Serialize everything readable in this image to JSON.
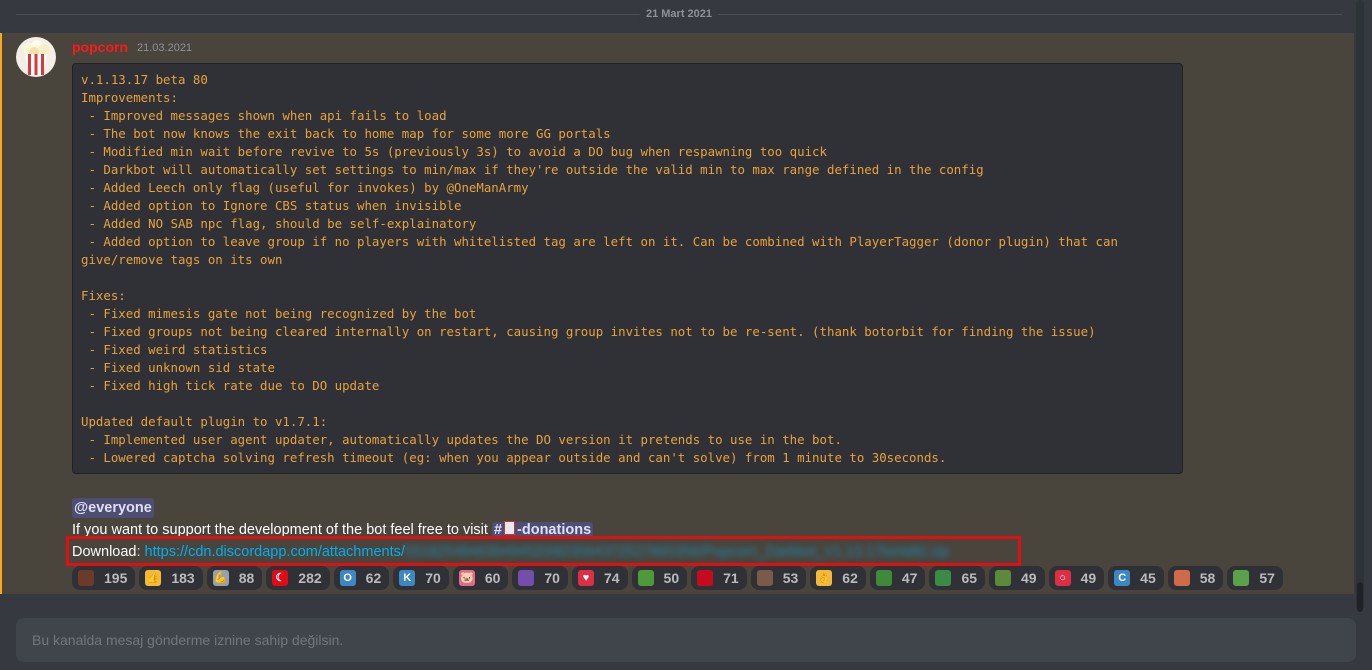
{
  "date_divider": "21 Mart 2021",
  "message": {
    "author": "popcorn",
    "timestamp": "21.03.2021",
    "code_lines": [
      "v.1.13.17 beta 80",
      "Improvements:",
      " - Improved messages shown when api fails to load",
      " - The bot now knows the exit back to home map for some more GG portals",
      " - Modified min wait before revive to 5s (previously 3s) to avoid a DO bug when respawning too quick",
      " - Darkbot will automatically set settings to min/max if they're outside the valid min to max range defined in the config",
      " - Added Leech only flag (useful for invokes) by @OneManArmy",
      " - Added option to Ignore CBS status when invisible",
      " - Added NO SAB npc flag, should be self-explainatory",
      " - Added option to leave group if no players with whitelisted tag are left on it. Can be combined with PlayerTagger (donor plugin) that can",
      "give/remove tags on its own",
      "",
      "Fixes:",
      " - Fixed mimesis gate not being recognized by the bot",
      " - Fixed groups not being cleared internally on restart, causing group invites not to be re-sent. (thank botorbit for finding the issue)",
      " - Fixed weird statistics",
      " - Fixed unknown sid state",
      " - Fixed high tick rate due to DO update",
      "",
      "Updated default plugin to v1.7.1:",
      " - Implemented user agent updater, automatically updates the DO version it pretends to use in the bot.",
      " - Lowered captcha solving refresh timeout (eg: when you appear outside and can't solve) from 1 minute to 30seconds."
    ],
    "mention": "@everyone",
    "support_text": "If you want to support the development of the bot feel free to visit ",
    "channel_mention": "-donations",
    "download_label": "Download: ",
    "download_url": "https://cdn.discordapp.com/attachments/",
    "download_url_blurred": "551825484639494520/823564372527865356/Popcorn_Darkbot_V1.13.17beta80.zip",
    "reactions": [
      {
        "icon": "bear-emoji",
        "count": "195",
        "color": "#6b3b2a",
        "glyph": ""
      },
      {
        "icon": "thumbs-up-emoji",
        "count": "183",
        "color": "#f5b93a",
        "glyph": "👍"
      },
      {
        "icon": "flexed-arm-emoji",
        "count": "88",
        "color": "#9aa0a8",
        "glyph": "💪"
      },
      {
        "icon": "turkey-flag-emoji",
        "count": "282",
        "color": "#e30a17",
        "glyph": "☾"
      },
      {
        "icon": "letter-o-emoji",
        "count": "62",
        "color": "#3b88c3",
        "glyph": "O"
      },
      {
        "icon": "letter-k-emoji",
        "count": "70",
        "color": "#3b88c3",
        "glyph": "K"
      },
      {
        "icon": "pig-face-emoji",
        "count": "60",
        "color": "#e36b8a",
        "glyph": "🐷"
      },
      {
        "icon": "eggplant-emoji",
        "count": "70",
        "color": "#744eaa",
        "glyph": ""
      },
      {
        "icon": "red-heart-emoji",
        "count": "74",
        "color": "#dd2e44",
        "glyph": "♥"
      },
      {
        "icon": "pepe-emoji",
        "count": "50",
        "color": "#4e9a3a",
        "glyph": ""
      },
      {
        "icon": "spain-flag-emoji",
        "count": "71",
        "color": "#c60b1e",
        "glyph": ""
      },
      {
        "icon": "person-emoji",
        "count": "53",
        "color": "#7a5a48",
        "glyph": ""
      },
      {
        "icon": "ok-hand-emoji",
        "count": "62",
        "color": "#f5b93a",
        "glyph": "👌"
      },
      {
        "icon": "pepe-note-emoji",
        "count": "47",
        "color": "#3f8a3a",
        "glyph": ""
      },
      {
        "icon": "pepe-glasses-emoji",
        "count": "65",
        "color": "#3c8b44",
        "glyph": ""
      },
      {
        "icon": "pepe-hat-emoji",
        "count": "49",
        "color": "#5a8a3a",
        "glyph": ""
      },
      {
        "icon": "red-circle-emoji",
        "count": "49",
        "color": "#dd2e44",
        "glyph": "○"
      },
      {
        "icon": "letter-c-emoji",
        "count": "45",
        "color": "#3b88c3",
        "glyph": "C"
      },
      {
        "icon": "face-emoji",
        "count": "58",
        "color": "#d06b4a",
        "glyph": ""
      },
      {
        "icon": "pepe-smile-emoji",
        "count": "57",
        "color": "#5aa14a",
        "glyph": ""
      }
    ]
  },
  "composer": {
    "placeholder": "Bu kanalda mesaj gönderme iznine sahip değilsin."
  }
}
